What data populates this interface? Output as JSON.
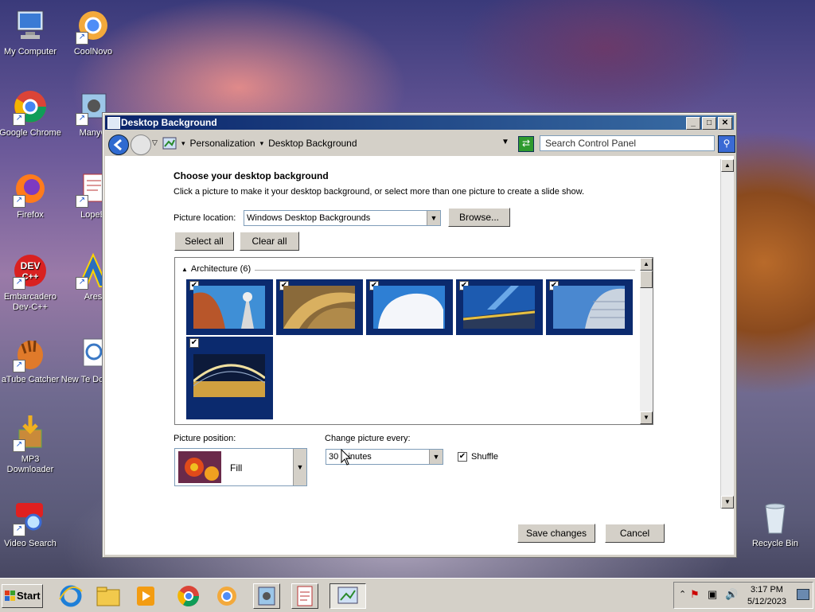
{
  "desktop": {
    "icons": [
      {
        "label": "My Computer",
        "icon": "computer-icon"
      },
      {
        "label": "CoolNovo",
        "icon": "coolnovo-icon"
      },
      {
        "label": "Google Chrome",
        "icon": "chrome-icon"
      },
      {
        "label": "ManyC",
        "icon": "manycam-icon"
      },
      {
        "label": "Firefox",
        "icon": "firefox-icon"
      },
      {
        "label": "LopeE",
        "icon": "lopeedit-icon"
      },
      {
        "label": "Embarcadero Dev-C++",
        "icon": "devcpp-icon"
      },
      {
        "label": "Ares",
        "icon": "ares-icon"
      },
      {
        "label": "aTube Catcher",
        "icon": "atube-icon"
      },
      {
        "label": "New Te Docume",
        "icon": "text-document-icon"
      },
      {
        "label": "MP3 Downloader",
        "icon": "mp3-downloader-icon"
      },
      {
        "label": "Video Search",
        "icon": "youtube-search-icon"
      },
      {
        "label": "Recycle Bin",
        "icon": "recycle-bin-icon"
      }
    ]
  },
  "window": {
    "title": "Desktop Background",
    "breadcrumb": [
      "Personalization",
      "Desktop Background"
    ],
    "search_placeholder": "Search Control Panel",
    "heading": "Choose your desktop background",
    "description": "Click a picture to make it your desktop background, or select more than one picture to create a slide show.",
    "picture_location_label": "Picture location:",
    "picture_location_value": "Windows Desktop Backgrounds",
    "browse_label": "Browse...",
    "select_all_label": "Select all",
    "clear_all_label": "Clear all",
    "group_label": "Architecture (6)",
    "picture_position_label": "Picture position:",
    "picture_position_value": "Fill",
    "change_every_label": "Change picture every:",
    "change_every_value": "30 minutes",
    "shuffle_label": "Shuffle",
    "save_label": "Save changes",
    "cancel_label": "Cancel"
  },
  "taskbar": {
    "start_label": "Start",
    "time": "3:17 PM",
    "date": "5/12/2023"
  }
}
